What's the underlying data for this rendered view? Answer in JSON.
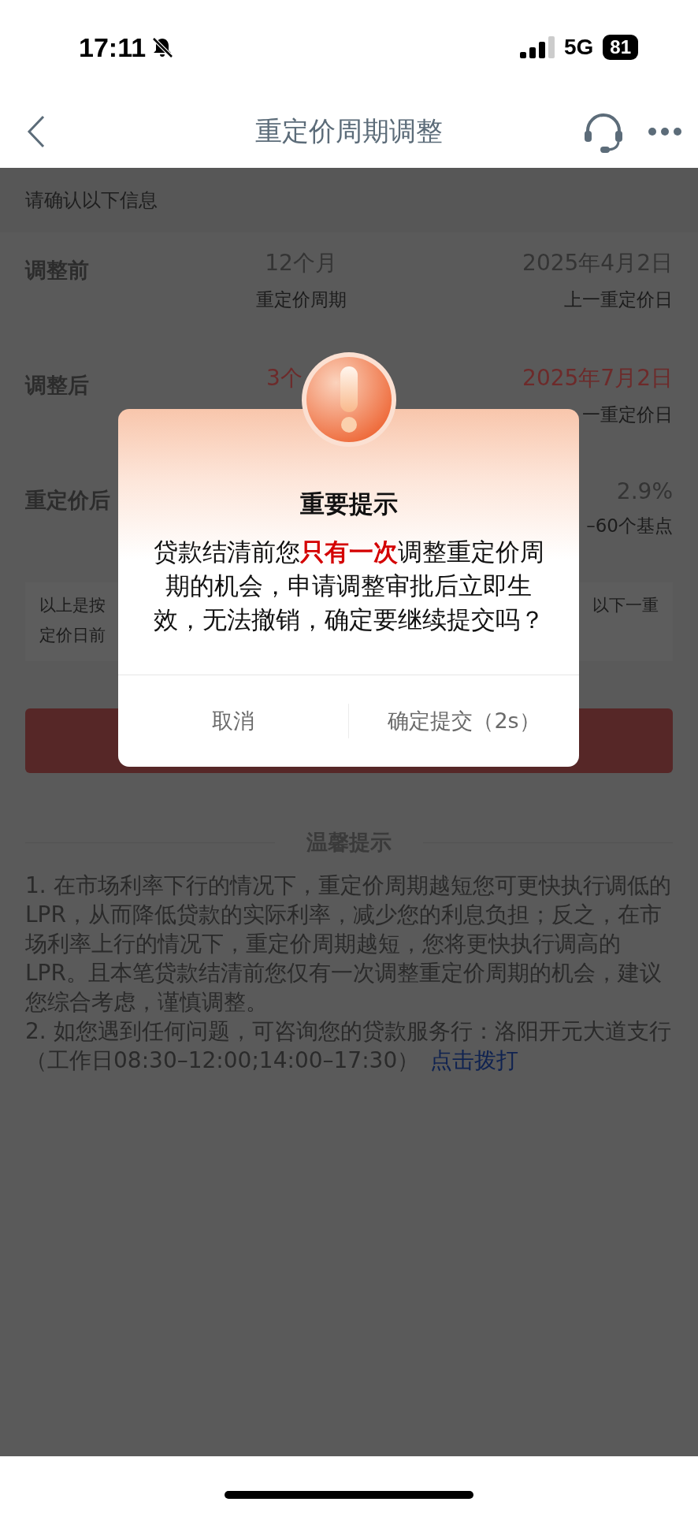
{
  "status_bar": {
    "time": "17:11",
    "network": "5G",
    "battery": "81"
  },
  "nav": {
    "title": "重定价周期调整"
  },
  "confirm_hint": "请确认以下信息",
  "rows": [
    {
      "label": "调整前",
      "value": "12个月",
      "value_caption": "重定价周期",
      "date": "2025年4月2日",
      "date_caption": "上一重定价日",
      "highlight": false
    },
    {
      "label": "调整后",
      "value": "3个",
      "date": "2025年7月2日",
      "date_caption": "一重定价日",
      "highlight": true
    },
    {
      "label": "重定价后",
      "date": "2.9%",
      "date_caption": "–60个基点",
      "highlight": false
    }
  ],
  "note": {
    "left_lines": [
      "以上是按",
      "定价日前"
    ],
    "right_lines": [
      "以下一重"
    ]
  },
  "tips": {
    "title": "温馨提示",
    "items": [
      {
        "text": "1. 在市场利率下行的情况下，重定价周期越短您可更快执行调低的LPR，从而降低贷款的实际利率，减少您的利息负担；反之，在市场利率上行的情况下，重定价周期越短，您将更快执行调高的LPR。且本笔贷款结清前您仅有一次调整重定价周期的机会，建议您综合考虑，谨慎调整。"
      },
      {
        "text": "2. 如您遇到任何问题，可咨询您的贷款服务行：洛阳开元大道支行（工作日08:30–12:00;14:00–17:30）",
        "link": "点击拨打"
      }
    ]
  },
  "dialog": {
    "title": "重要提示",
    "message": "贷款结清前您**只有一次**调整重定价周期的机会，申请调整审批后立即生效，无法撤销，确定要继续提交吗？",
    "buttons": [
      "取消",
      "确定提交（2s）"
    ]
  }
}
